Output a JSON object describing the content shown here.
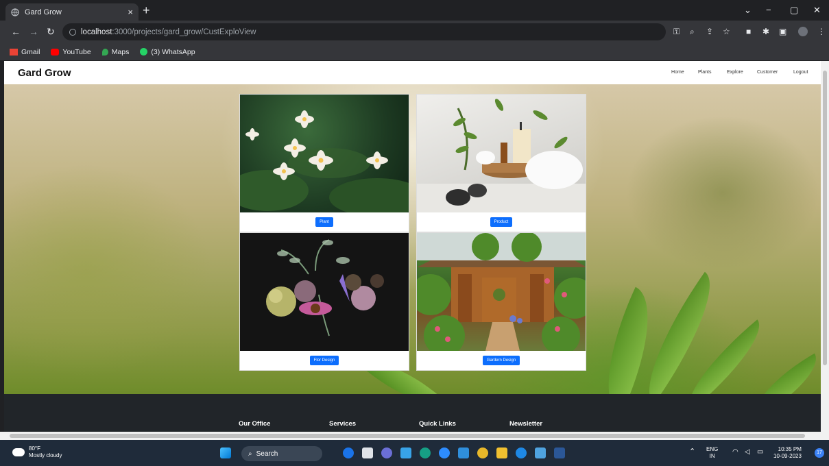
{
  "browser": {
    "tab_title": "Gard Grow",
    "tab_close": "×",
    "new_tab": "+",
    "window_controls": {
      "minimize": "−",
      "restore": "▢",
      "close": "✕",
      "tabs_menu": "⌄"
    },
    "url_host": "localhost",
    "url_rest": ":3000/projects/gard_grow/CustExploView",
    "bookmarks": [
      {
        "label": "Gmail",
        "color": "#ea4335"
      },
      {
        "label": "YouTube",
        "color": "#ff0000"
      },
      {
        "label": "Maps",
        "color": "#34a853"
      },
      {
        "label": "(3) WhatsApp",
        "color": "#25d366"
      }
    ]
  },
  "navbar": {
    "brand": "Gard Grow",
    "links": [
      "Home",
      "Plants",
      "Explore",
      "Customer",
      "Logout"
    ]
  },
  "cards": [
    {
      "button": "Plant"
    },
    {
      "button": "Product"
    },
    {
      "button": "Flor Design"
    },
    {
      "button": "Gardern Design"
    }
  ],
  "footer": {
    "headings": [
      "Our Office",
      "Services",
      "Quick Links",
      "Newsletter"
    ]
  },
  "taskbar": {
    "weather_temp": "80°F",
    "weather_desc": "Mostly cloudy",
    "search_label": "Search",
    "lang_top": "ENG",
    "lang_bottom": "IN",
    "time": "10:35 PM",
    "date": "10-09-2023",
    "notification_count": "17"
  },
  "colors": {
    "primary_button": "#0d6efd",
    "footer_bg": "#212529",
    "taskbar_bg": "#1f2b3a"
  }
}
